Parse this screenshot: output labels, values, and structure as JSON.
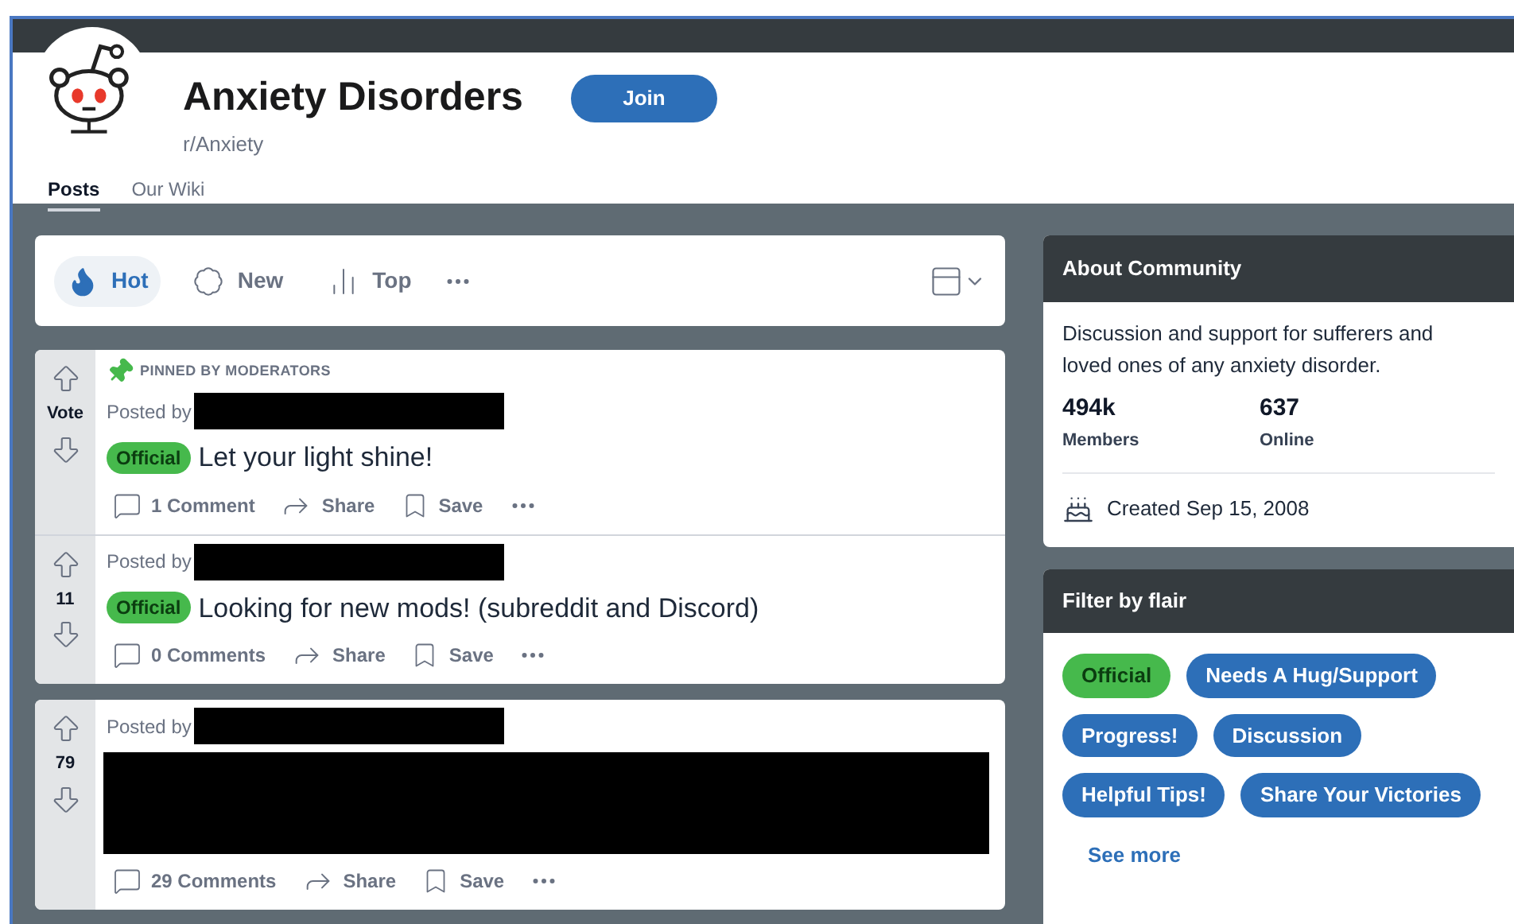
{
  "community": {
    "name": "Anxiety Disorders",
    "handle": "r/Anxiety",
    "join_label": "Join"
  },
  "nav_tabs": [
    {
      "label": "Posts",
      "selected": true
    },
    {
      "label": "Our Wiki",
      "selected": false
    }
  ],
  "sort_tabs": [
    {
      "label": "Hot",
      "kind": "hot",
      "selected": true
    },
    {
      "label": "New",
      "kind": "new",
      "selected": false
    },
    {
      "label": "Top",
      "kind": "top",
      "selected": false
    }
  ],
  "post_cards": [
    {
      "posts": [
        {
          "pinned_label": "PINNED BY MODERATORS",
          "score": "Vote",
          "posted_by": "Posted by",
          "author_redacted": true,
          "flair": {
            "label": "Official",
            "color": "#46b94c"
          },
          "title": "Let your light shine!",
          "title_redacted": false,
          "comments": "1 Comment",
          "share": "Share",
          "save": "Save"
        },
        {
          "score": "11",
          "posted_by": "Posted by",
          "author_redacted": true,
          "flair": {
            "label": "Official",
            "color": "#46b94c"
          },
          "title": "Looking for new mods! (subreddit and Discord)",
          "title_redacted": false,
          "comments": "0 Comments",
          "share": "Share",
          "save": "Save"
        }
      ]
    },
    {
      "posts": [
        {
          "score": "79",
          "posted_by": "Posted by",
          "author_redacted": true,
          "title_redacted": true,
          "comments": "29 Comments",
          "share": "Share",
          "save": "Save"
        }
      ]
    }
  ],
  "about": {
    "heading": "About Community",
    "description": "Discussion and support for sufferers and loved ones of any anxiety disorder.",
    "stats": [
      {
        "value": "494k",
        "label": "Members"
      },
      {
        "value": "637",
        "label": "Online"
      }
    ],
    "created": "Created Sep 15, 2008"
  },
  "flair_filter": {
    "heading": "Filter by flair",
    "flairs": [
      {
        "label": "Official",
        "color": "#46b94c"
      },
      {
        "label": "Needs A Hug/Support",
        "color": "#2d6fb8"
      },
      {
        "label": "Progress!",
        "color": "#2d6fb8"
      },
      {
        "label": "Discussion",
        "color": "#2d6fb8"
      },
      {
        "label": "Helpful Tips!",
        "color": "#2d6fb8"
      },
      {
        "label": "Share Your Victories",
        "color": "#2d6fb8"
      }
    ],
    "see_more": "See more"
  }
}
